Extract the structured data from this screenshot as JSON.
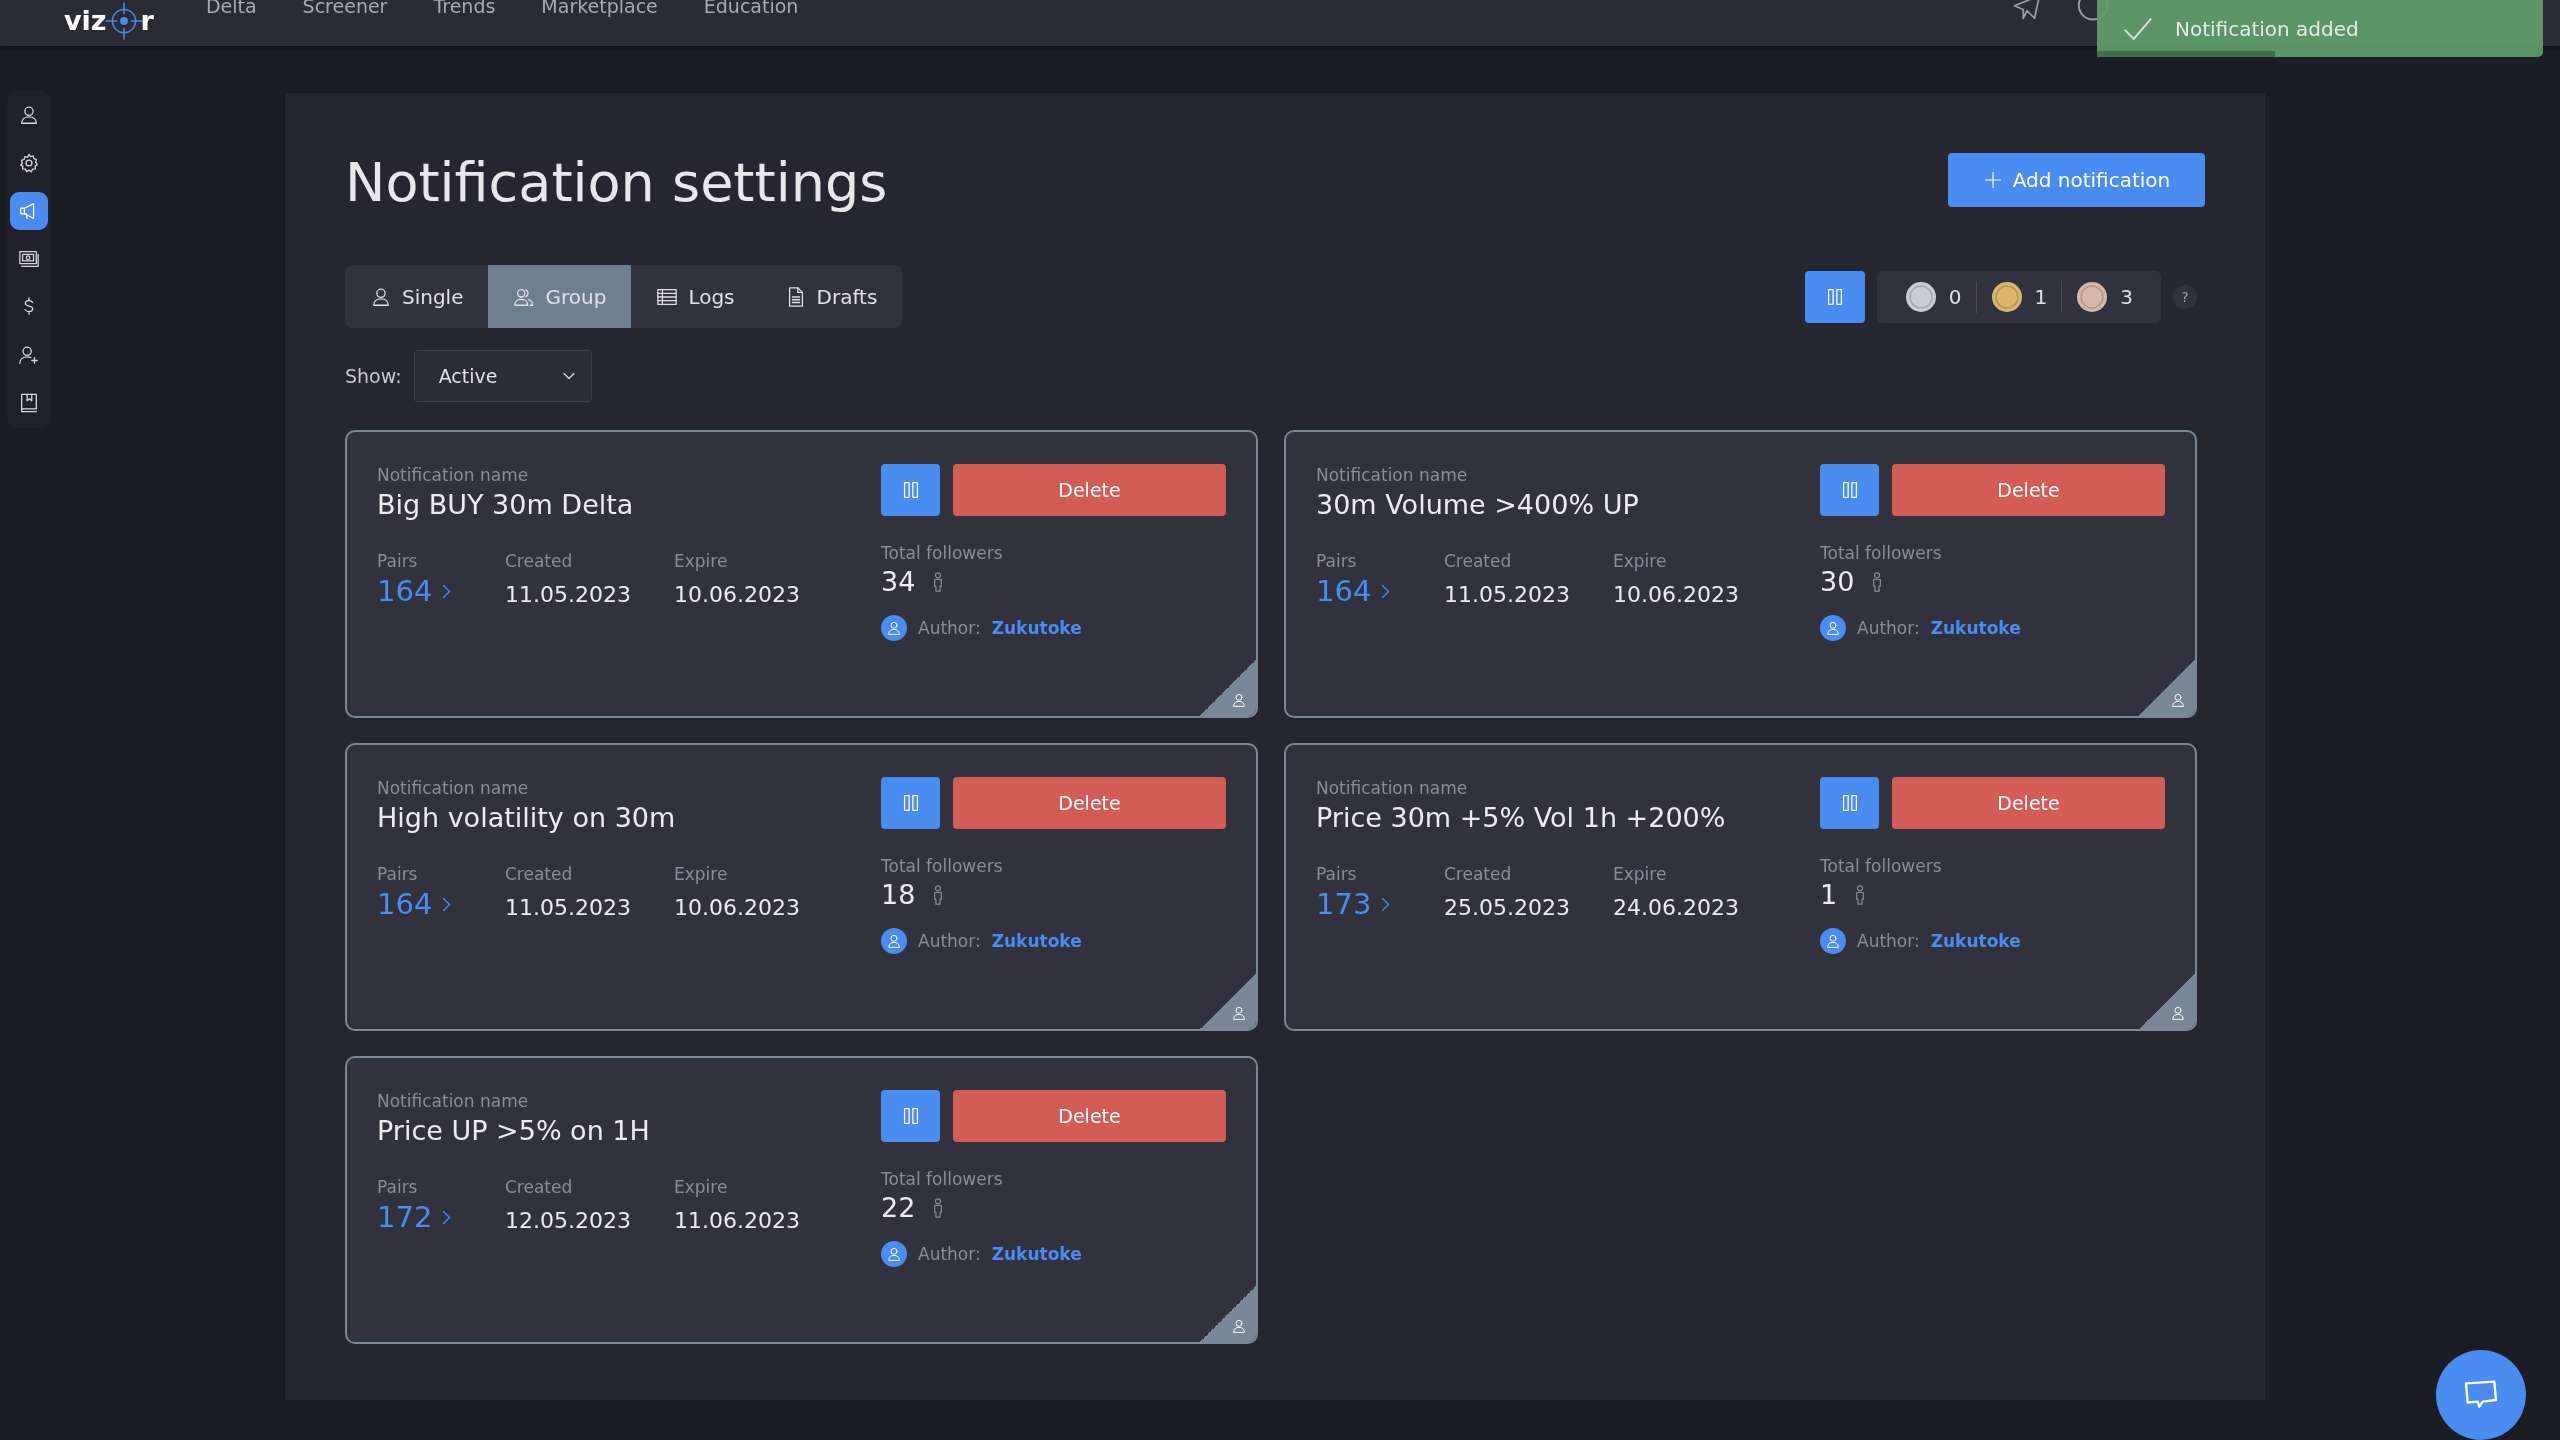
{
  "header": {
    "logo": [
      "viz",
      "r"
    ],
    "nav": [
      "Delta",
      "Screener",
      "Trends",
      "Marketplace",
      "Education"
    ]
  },
  "toast": {
    "message": "Notification added",
    "level": 0.4
  },
  "sidebar": {
    "items": [
      {
        "kind": "user",
        "selected": false
      },
      {
        "kind": "gear",
        "selected": false
      },
      {
        "kind": "megaphone",
        "selected": true
      },
      {
        "kind": "cash",
        "selected": false
      },
      {
        "kind": "dollar",
        "selected": false
      },
      {
        "kind": "user-plus",
        "selected": false
      },
      {
        "kind": "book",
        "selected": false
      }
    ]
  },
  "page": {
    "title": "Notification settings",
    "add_button": "Add notification"
  },
  "tabs": [
    {
      "label": "Single",
      "kind": "user",
      "selected": false
    },
    {
      "label": "Group",
      "kind": "group",
      "selected": true
    },
    {
      "label": "Logs",
      "kind": "table",
      "selected": false
    },
    {
      "label": "Drafts",
      "kind": "document",
      "selected": false
    }
  ],
  "medals": [
    {
      "count": "0",
      "color": "#c9ccd3"
    },
    {
      "count": "1",
      "color": "#ddb66e"
    },
    {
      "count": "3",
      "color": "#d6b9aa"
    }
  ],
  "help": "?",
  "filter": {
    "label": "Show:",
    "value": "Active"
  },
  "cards": [
    {
      "name_label": "Notification name",
      "name": "Big BUY 30m Delta",
      "pairs_label": "Pairs",
      "pairs": "164",
      "created_label": "Created",
      "created": "11.05.2023",
      "expire_label": "Expire",
      "expire": "10.06.2023",
      "followers_label": "Total followers",
      "followers": "34",
      "author_label": "Author:",
      "author": "Zukutoke",
      "delete": "Delete"
    },
    {
      "name_label": "Notification name",
      "name": "30m Volume >400% UP",
      "pairs_label": "Pairs",
      "pairs": "164",
      "created_label": "Created",
      "created": "11.05.2023",
      "expire_label": "Expire",
      "expire": "10.06.2023",
      "followers_label": "Total followers",
      "followers": "30",
      "author_label": "Author:",
      "author": "Zukutoke",
      "delete": "Delete"
    },
    {
      "name_label": "Notification name",
      "name": "High volatility on 30m",
      "pairs_label": "Pairs",
      "pairs": "164",
      "created_label": "Created",
      "created": "11.05.2023",
      "expire_label": "Expire",
      "expire": "10.06.2023",
      "followers_label": "Total followers",
      "followers": "18",
      "author_label": "Author:",
      "author": "Zukutoke",
      "delete": "Delete"
    },
    {
      "name_label": "Notification name",
      "name": "Price 30m +5% Vol 1h +200%",
      "pairs_label": "Pairs",
      "pairs": "173",
      "created_label": "Created",
      "created": "25.05.2023",
      "expire_label": "Expire",
      "expire": "24.06.2023",
      "followers_label": "Total followers",
      "followers": "1",
      "author_label": "Author:",
      "author": "Zukutoke",
      "delete": "Delete"
    },
    {
      "name_label": "Notification name",
      "name": "Price UP >5% on 1H",
      "pairs_label": "Pairs",
      "pairs": "172",
      "created_label": "Created",
      "created": "12.05.2023",
      "expire_label": "Expire",
      "expire": "11.06.2023",
      "followers_label": "Total followers",
      "followers": "22",
      "author_label": "Author:",
      "author": "Zukutoke",
      "delete": "Delete"
    }
  ]
}
